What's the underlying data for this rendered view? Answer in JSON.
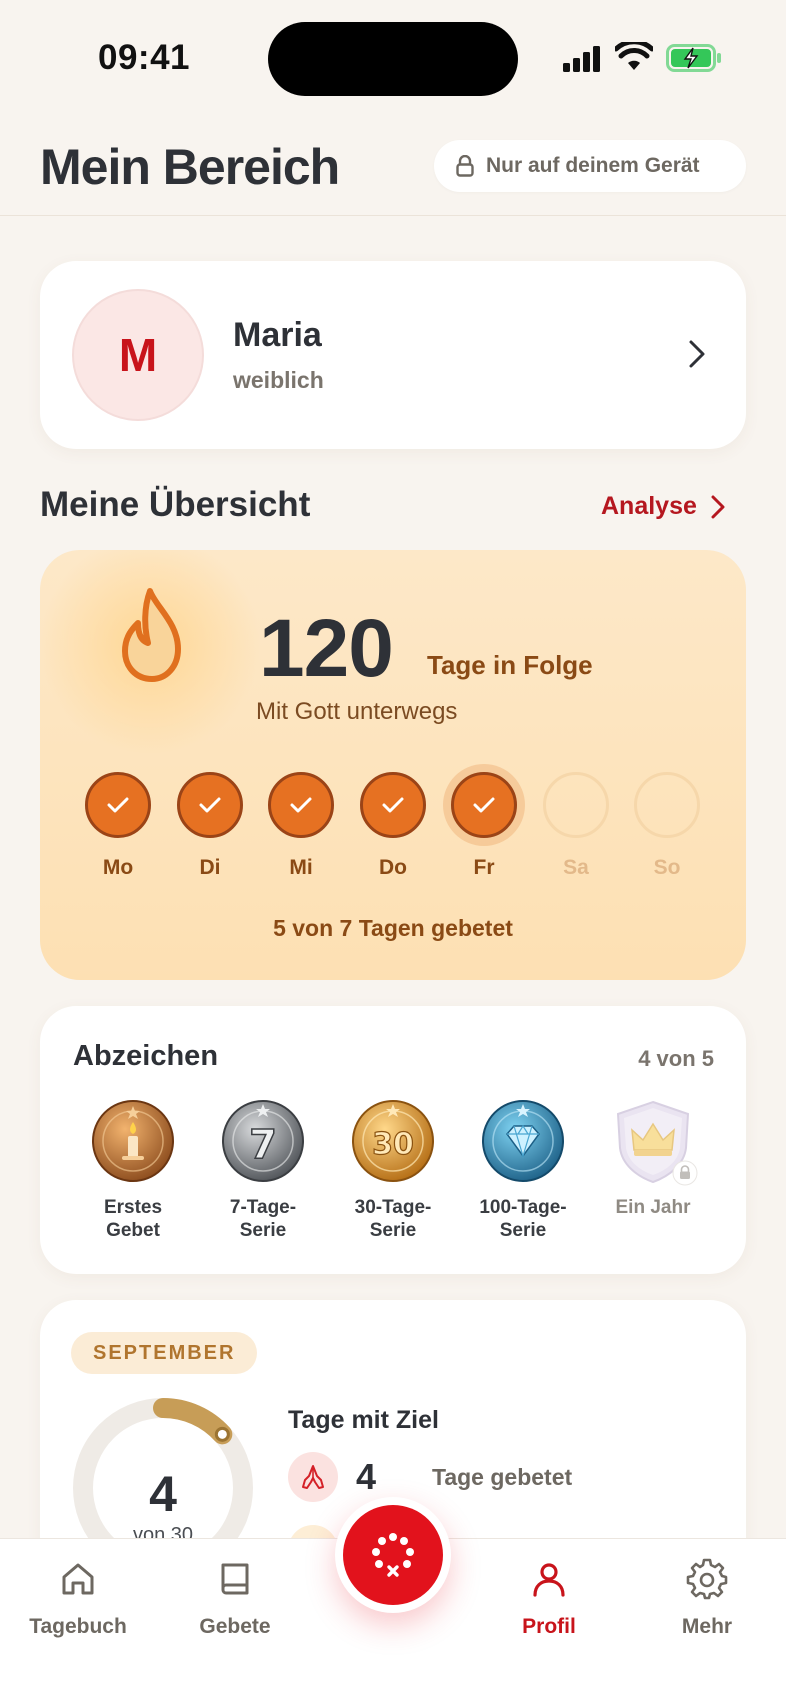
{
  "status_bar": {
    "time": "09:41"
  },
  "header": {
    "title": "Mein Bereich",
    "privacy_label": "Nur auf deinem Gerät"
  },
  "profile": {
    "initial": "M",
    "name": "Maria",
    "gender": "weiblich"
  },
  "overview": {
    "title": "Meine Übersicht",
    "analyse_label": "Analyse"
  },
  "streak": {
    "count": "120",
    "unit": "Tage in Folge",
    "subtitle": "Mit Gott unterwegs",
    "days": [
      {
        "label": "Mo",
        "done": true
      },
      {
        "label": "Di",
        "done": true
      },
      {
        "label": "Mi",
        "done": true
      },
      {
        "label": "Do",
        "done": true
      },
      {
        "label": "Fr",
        "done": true,
        "today": true
      },
      {
        "label": "Sa",
        "done": false
      },
      {
        "label": "So",
        "done": false
      }
    ],
    "summary": "5 von 7 Tagen gebetet",
    "colors": {
      "done": "#e67122",
      "border": "#9b4417",
      "text": "#8a4a15"
    }
  },
  "badges": {
    "title": "Abzeichen",
    "count": "4 von 5",
    "items": [
      {
        "line1": "Erstes",
        "line2": "Gebet",
        "icon": "candle-bronze-medal-icon"
      },
      {
        "line1": "7-Tage-",
        "line2": "Serie",
        "icon": "silver-7-medal-icon"
      },
      {
        "line1": "30-Tage-",
        "line2": "Serie",
        "icon": "gold-30-medal-icon"
      },
      {
        "line1": "100-Tage-",
        "line2": "Serie",
        "icon": "diamond-medal-icon"
      },
      {
        "line1": "Ein Jahr",
        "line2": "",
        "icon": "crown-shield-locked-icon",
        "locked": true
      }
    ]
  },
  "month": {
    "label": "SEPTEMBER",
    "ring_value": "4",
    "ring_sub": "von 30",
    "progress": 0.133,
    "goal_title": "Tage mit Ziel",
    "prayed_count": "4",
    "prayed_label": "Tage gebetet"
  },
  "tabbar": {
    "tabs": [
      {
        "label": "Tagebuch",
        "icon": "home-icon"
      },
      {
        "label": "Gebete",
        "icon": "book-icon"
      },
      {
        "label": "Profil",
        "icon": "person-icon",
        "active": true
      },
      {
        "label": "Mehr",
        "icon": "gear-icon"
      }
    ],
    "accent": "#c8141b"
  }
}
